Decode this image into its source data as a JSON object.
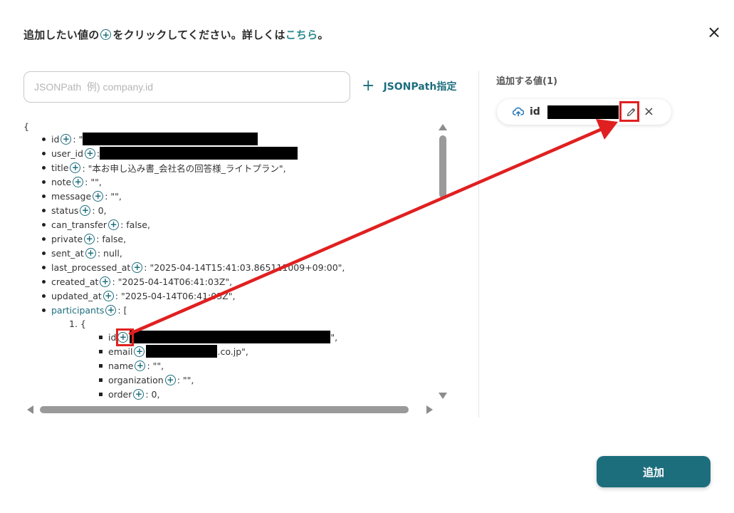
{
  "header": {
    "text_before": "追加したい値の",
    "text_after": "をクリックしてください。詳しくは",
    "link": "こちら",
    "end": "。",
    "plus_symbol": "+"
  },
  "close_symbol": "×",
  "search": {
    "placeholder": "JSONPath  例) company.id",
    "value": ""
  },
  "jsonpath_button": {
    "plus": "+",
    "label": "JSONPath指定"
  },
  "json_tree": {
    "open_brace": "{",
    "lines": [
      {
        "key": "id",
        "suffix": ": \"",
        "redacted": true
      },
      {
        "key": "user_id",
        "suffix": ": ",
        "redacted": true
      },
      {
        "key": "title",
        "suffix": ": \"本お申し込み書_会社名の回答様_ライトプラン\","
      },
      {
        "key": "note",
        "suffix": ": \"\","
      },
      {
        "key": "message",
        "suffix": ": \"\","
      },
      {
        "key": "status",
        "suffix": ": 0,"
      },
      {
        "key": "can_transfer",
        "suffix": ": false,"
      },
      {
        "key": "private",
        "suffix": ": false,"
      },
      {
        "key": "sent_at",
        "suffix": ": null,"
      },
      {
        "key": "last_processed_at",
        "suffix": ": \"2025-04-14T15:41:03.865111009+09:00\","
      },
      {
        "key": "created_at",
        "suffix": ": \"2025-04-14T06:41:03Z\","
      },
      {
        "key": "updated_at",
        "suffix": ": \"2025-04-14T06:41:03Z\","
      },
      {
        "key": "participants",
        "suffix": ": ["
      }
    ],
    "list_item": "1. {",
    "nested": [
      {
        "key": "id",
        "suffix": "\",",
        "redacted": true
      },
      {
        "key": "email",
        "suffix": ".co.jp\",",
        "redacted": true
      },
      {
        "key": "name",
        "suffix": ": \"\","
      },
      {
        "key": "organization",
        "suffix": ": \"\","
      },
      {
        "key": "order",
        "suffix": ": 0,"
      }
    ]
  },
  "added_values": {
    "title": "追加する値(1)",
    "chip_label": "id",
    "remove_symbol": "×"
  },
  "submit_label": "追加",
  "colors": {
    "accent": "#1d6e7d",
    "link": "#2a8a8e",
    "annotation": "#e02020"
  }
}
